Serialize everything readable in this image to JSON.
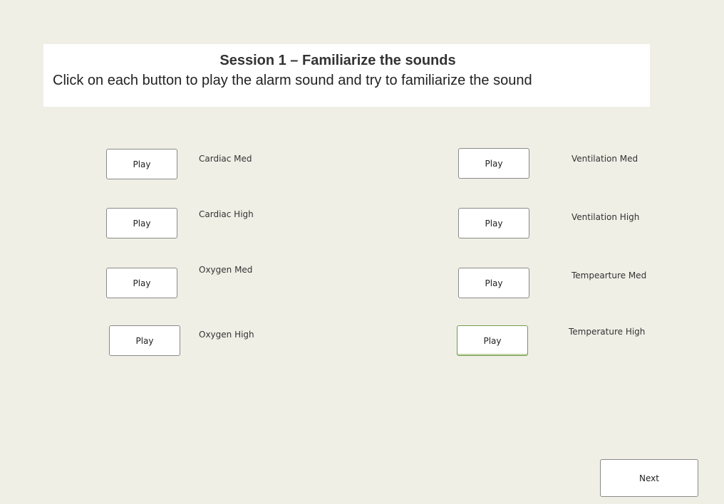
{
  "header": {
    "title": "Session 1 – Familiarize the sounds",
    "subtitle": "Click on each button to play the alarm sound and try to familiarize the sound"
  },
  "sounds": [
    {
      "button_label": "Play",
      "label": "Cardiac Med"
    },
    {
      "button_label": "Play",
      "label": "Cardiac High"
    },
    {
      "button_label": "Play",
      "label": "Oxygen Med"
    },
    {
      "button_label": "Play",
      "label": "Oxygen High"
    },
    {
      "button_label": "Play",
      "label": "Ventilation Med"
    },
    {
      "button_label": "Play",
      "label": "Ventilation High"
    },
    {
      "button_label": "Play",
      "label": "Tempearture Med"
    },
    {
      "button_label": "Play",
      "label": "Temperature High"
    }
  ],
  "footer": {
    "next_label": "Next"
  },
  "colors": {
    "background": "#f0efe6",
    "panel": "#ffffff",
    "focus_border": "#6f9d52"
  }
}
